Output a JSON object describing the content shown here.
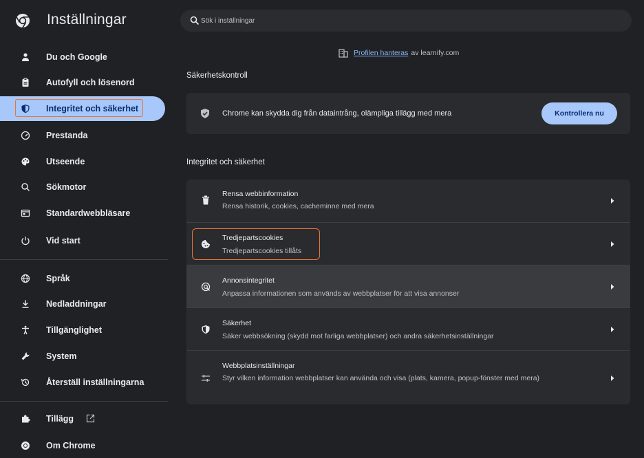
{
  "header": {
    "title": "Inställningar",
    "search_placeholder": "Sök i inställningar"
  },
  "managed": {
    "link_text": "Profilen hanteras",
    "suffix_text": "av learnify.com"
  },
  "sidebar": {
    "items": [
      {
        "label": "Du och Google",
        "icon": "person-icon"
      },
      {
        "label": "Autofyll och lösenord",
        "icon": "clipboard-icon"
      },
      {
        "label": "Integritet och säkerhet",
        "icon": "shield-icon"
      },
      {
        "label": "Prestanda",
        "icon": "speedometer-icon"
      },
      {
        "label": "Utseende",
        "icon": "palette-icon"
      },
      {
        "label": "Sökmotor",
        "icon": "search-icon"
      },
      {
        "label": "Standardwebbläsare",
        "icon": "browser-icon"
      },
      {
        "label": "Vid start",
        "icon": "power-icon"
      },
      {
        "label": "Språk",
        "icon": "globe-icon"
      },
      {
        "label": "Nedladdningar",
        "icon": "download-icon"
      },
      {
        "label": "Tillgänglighet",
        "icon": "accessibility-icon"
      },
      {
        "label": "System",
        "icon": "wrench-icon"
      },
      {
        "label": "Återställ inställningarna",
        "icon": "restore-icon"
      },
      {
        "label": "Tillägg",
        "icon": "puzzle-icon"
      },
      {
        "label": "Om Chrome",
        "icon": "chrome-icon"
      }
    ],
    "active_index": 2
  },
  "safety": {
    "section_title": "Säkerhetskontroll",
    "text": "Chrome kan skydda dig från dataintrång, olämpliga tillägg med mera",
    "button_label": "Kontrollera nu"
  },
  "privacy": {
    "section_title": "Integritet och säkerhet",
    "rows": [
      {
        "title": "Rensa webbinformation",
        "subtitle": "Rensa historik, cookies, cacheminne med mera",
        "icon": "trash-icon"
      },
      {
        "title": "Tredjepartscookies",
        "subtitle": "Tredjepartscookies tillåts",
        "icon": "cookie-icon"
      },
      {
        "title": "Annonsintegritet",
        "subtitle": "Anpassa informationen som används av webbplatser för att visa annonser",
        "icon": "ad-privacy-icon"
      },
      {
        "title": "Säkerhet",
        "subtitle": "Säker webbsökning (skydd mot farliga webbplatser) och andra säkerhetsinställningar",
        "icon": "shield-icon"
      },
      {
        "title": "Webbplatsinställningar",
        "subtitle": "Styr vilken information webbplatser kan använda och visa (plats, kamera, popup-fönster med mera)",
        "icon": "sliders-icon"
      }
    ]
  },
  "colors": {
    "background": "#202124",
    "card": "#2a2b2e",
    "accent": "#a8c7fa",
    "highlight_outline": "#e8743b",
    "link": "#8ab4f8"
  }
}
